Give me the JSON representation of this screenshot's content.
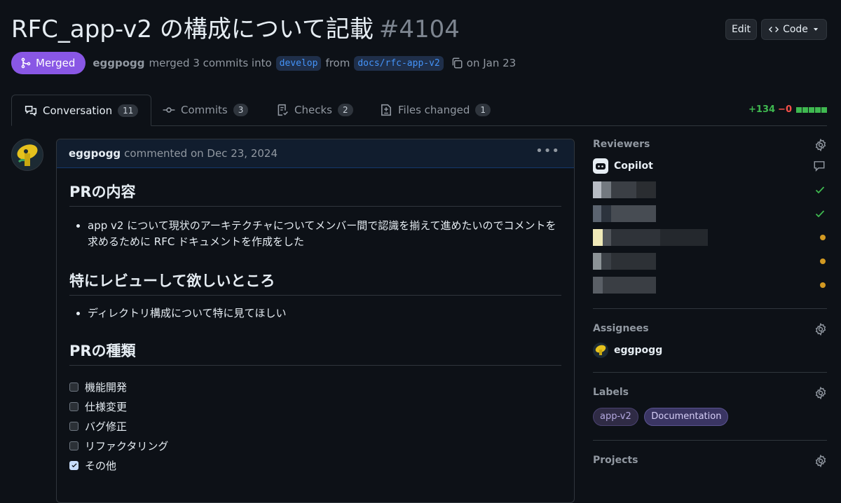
{
  "header": {
    "title": "RFC_app-v2 の構成について記載",
    "number": "#4104",
    "edit_label": "Edit",
    "code_label": "Code"
  },
  "meta": {
    "status": "Merged",
    "author": "eggpogg",
    "action": "merged 3 commits into",
    "base_branch": "develop",
    "from_text": "from",
    "head_branch": "docs/rfc-app-v2",
    "date_text": "on Jan 23"
  },
  "tabs": [
    {
      "label": "Conversation",
      "count": "11",
      "icon": "comment-discussion-icon"
    },
    {
      "label": "Commits",
      "count": "3",
      "icon": "commit-icon"
    },
    {
      "label": "Checks",
      "count": "2",
      "icon": "checklist-icon"
    },
    {
      "label": "Files changed",
      "count": "1",
      "icon": "file-diff-icon"
    }
  ],
  "diffstat": {
    "additions": "+134",
    "deletions": "−0"
  },
  "comment": {
    "author": "eggpogg",
    "meta": "commented on Dec 23, 2024",
    "sections": [
      {
        "heading": "PRの内容",
        "items": [
          "app v2 について現状のアーキテクチャについてメンバー間で認識を揃えて進めたいのでコメントを求めるために RFC ドキュメントを作成をした"
        ]
      },
      {
        "heading": "特にレビューして欲しいところ",
        "items": [
          "ディレクトリ構成について特に見てほしい"
        ]
      },
      {
        "heading": "PRの種類"
      }
    ],
    "tasks": [
      {
        "label": "機能開発",
        "checked": false
      },
      {
        "label": "仕様変更",
        "checked": false
      },
      {
        "label": "バグ修正",
        "checked": false
      },
      {
        "label": "リファクタリング",
        "checked": false
      },
      {
        "label": "その他",
        "checked": true
      }
    ]
  },
  "sidebar": {
    "reviewers": {
      "title": "Reviewers",
      "copilot": "Copilot",
      "statuses": [
        "comment",
        "approved",
        "approved",
        "pending",
        "pending",
        "pending"
      ]
    },
    "assignees": {
      "title": "Assignees",
      "user": "eggpogg"
    },
    "labels": {
      "title": "Labels",
      "items": [
        {
          "name": "app-v2",
          "color": "#2f2b45",
          "text": "#b4a8e0"
        },
        {
          "name": "Documentation",
          "color": "#3a3563",
          "text": "#d7cff8"
        }
      ]
    },
    "projects": {
      "title": "Projects"
    }
  },
  "colors": {
    "merged": "#8957e5",
    "accent": "#4493f8",
    "success": "#3fb950",
    "pending": "#d29922"
  }
}
